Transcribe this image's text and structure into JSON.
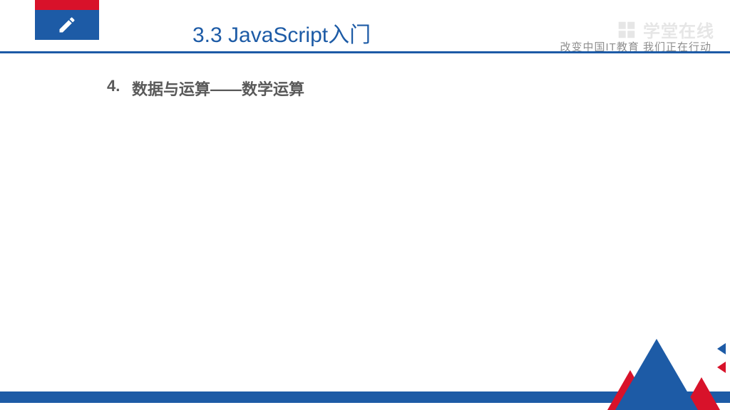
{
  "header": {
    "title": "3.3 JavaScript入门",
    "tagline": "改变中国IT教育  我们正在行动"
  },
  "content": {
    "number": "4.",
    "heading": "数据与运算——数学运算"
  },
  "watermark": {
    "text": "学堂在线"
  },
  "colors": {
    "primary_blue": "#1d5ba6",
    "accent_red": "#d8122a",
    "text_gray": "#595959",
    "muted_gray": "#8f8f8f"
  }
}
